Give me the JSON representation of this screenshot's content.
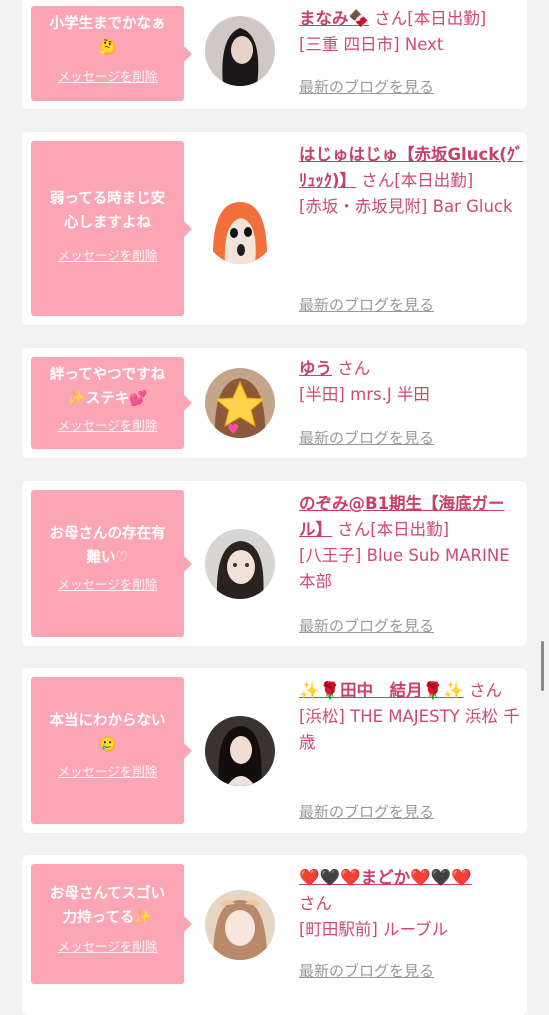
{
  "delete_label": "メッセージを削除",
  "blog_label": "最新のブログを見る",
  "cards": [
    {
      "message": "小学生までかなぁ\n🤔",
      "name": "まなみ🍫",
      "suffix": "さん[本日出勤]",
      "shop": "[三重 四日市] Next",
      "avatar_icon": "girl-photo-avatar"
    },
    {
      "message": "弱ってる時まじ安\n心しますよね",
      "name": "はじゅはじゅ【赤坂Gluck(ｸﾞﾘｭｯｸ)】",
      "suffix": "さん[本日出勤]",
      "shop": "[赤坂・赤坂見附] Bar Gluck",
      "avatar_icon": "cartoon-avatar"
    },
    {
      "message": "絆ってやつですね\n✨ステキ💕",
      "name": "ゆう",
      "suffix": "さん",
      "shop": "[半田] mrs.J 半田",
      "avatar_icon": "star-covered-avatar"
    },
    {
      "message": "お母さんの存在有\n難い♡",
      "name": "のぞみ@B1期生【海底ガール】",
      "suffix": "さん[本日出勤]",
      "shop": "[八王子] Blue Sub MARINE 本部",
      "avatar_icon": "girl-photo-avatar"
    },
    {
      "message": "本当にわからない\n🥲",
      "name": "✨🌹田中　結月🌹✨",
      "suffix": "さん",
      "shop": "[浜松] THE MAJESTY 浜松 千歳",
      "avatar_icon": "girl-photo-avatar"
    },
    {
      "message": "お母さんてスゴい\n力持ってる✨",
      "name": "❤️🖤❤️まどか❤️🖤❤️",
      "suffix": "さん",
      "shop": "[町田駅前] ルーブル",
      "avatar_icon": "girl-photo-avatar"
    }
  ]
}
